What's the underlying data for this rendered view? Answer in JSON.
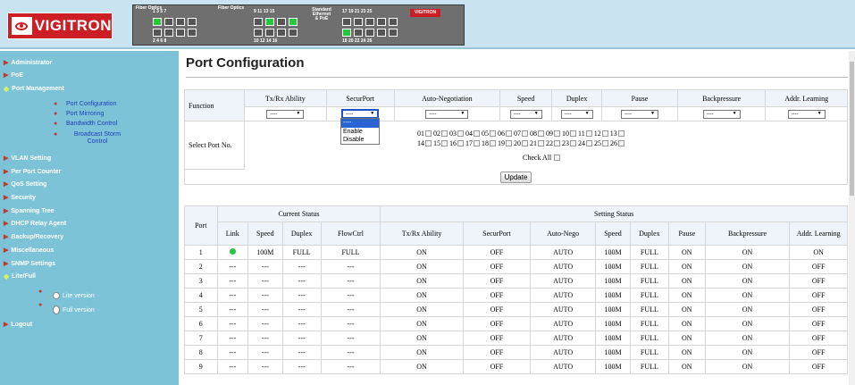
{
  "banner": {
    "logo_text": "VIGITRON",
    "switch_labels": {
      "fiber_optics_1": "Fiber Optics",
      "fiber_optics_2": "Fiber Optics",
      "standard": "Standard Ethernet & PoE",
      "brand": "VIGITRON",
      "group1_top": "1 3 5 7",
      "group1_bottom": "2 4 6 8",
      "group2_top": "9 11 13 15",
      "group2_bottom": "10 12 14 16",
      "group3_top": "17 19 21 23 25",
      "group3_bottom": "18 20 22 24 26"
    },
    "brand_color": "#cc1f25"
  },
  "sidebar": {
    "items": [
      {
        "label": "Administrator"
      },
      {
        "label": "PoE"
      },
      {
        "label": "Port Management"
      },
      {
        "label": "VLAN Setting"
      },
      {
        "label": "Per Port Counter"
      },
      {
        "label": "QoS Setting"
      },
      {
        "label": "Security"
      },
      {
        "label": "Spanning Tree"
      },
      {
        "label": "DHCP Relay Agent"
      },
      {
        "label": "Backup/Recovery"
      },
      {
        "label": "Miscellaneous"
      },
      {
        "label": "SNMP Settings"
      },
      {
        "label": "Lite/Full"
      },
      {
        "label": "Logout"
      }
    ],
    "port_mgmt_sub": [
      "Port Configuration",
      "Port Mirroring",
      "Bandwidth Control",
      "Broadcast Storm Control"
    ],
    "lite_full": {
      "lite": "Lite version",
      "full": "Full version",
      "selected": "full"
    }
  },
  "main": {
    "title": "Port Configuration",
    "config": {
      "function_label": "Function",
      "headers": [
        "Tx/Rx Ability",
        "SecurPort",
        "Auto-Negotiation",
        "Speed",
        "Duplex",
        "Pause",
        "Backpressure",
        "Addr. Learning"
      ],
      "select_value": "----",
      "dropdown_options": [
        "----",
        "Enable",
        "Disable"
      ],
      "select_port_label": "Select Port No.",
      "ports_row1": [
        "01",
        "02",
        "03",
        "04",
        "05",
        "06",
        "07",
        "08",
        "09",
        "10",
        "11",
        "12",
        "13"
      ],
      "ports_row2": [
        "14",
        "15",
        "16",
        "17",
        "18",
        "19",
        "20",
        "21",
        "22",
        "23",
        "24",
        "25",
        "26"
      ],
      "check_all": "Check All",
      "update": "Update"
    },
    "status": {
      "port_header": "Port",
      "current_header": "Current Status",
      "setting_header": "Setting Status",
      "columns": [
        "Link",
        "Speed",
        "Duplex",
        "FlowCtrl",
        "Tx/Rx Ability",
        "SecurPort",
        "Auto-Nego",
        "Speed",
        "Duplex",
        "Pause",
        "Backpressure",
        "Addr. Learning"
      ],
      "rows": [
        {
          "port": "1",
          "link": "up",
          "speed": "100M",
          "duplex": "FULL",
          "flow": "FULL",
          "txrx": "ON",
          "secur": "OFF",
          "nego": "AUTO",
          "sspeed": "100M",
          "sduplex": "FULL",
          "pause": "ON",
          "back": "ON",
          "learn": "ON"
        },
        {
          "port": "2",
          "link": "---",
          "speed": "---",
          "duplex": "---",
          "flow": "---",
          "txrx": "ON",
          "secur": "OFF",
          "nego": "AUTO",
          "sspeed": "100M",
          "sduplex": "FULL",
          "pause": "ON",
          "back": "ON",
          "learn": "OFF"
        },
        {
          "port": "3",
          "link": "---",
          "speed": "---",
          "duplex": "---",
          "flow": "---",
          "txrx": "ON",
          "secur": "OFF",
          "nego": "AUTO",
          "sspeed": "100M",
          "sduplex": "FULL",
          "pause": "ON",
          "back": "ON",
          "learn": "OFF"
        },
        {
          "port": "4",
          "link": "---",
          "speed": "---",
          "duplex": "---",
          "flow": "---",
          "txrx": "ON",
          "secur": "OFF",
          "nego": "AUTO",
          "sspeed": "100M",
          "sduplex": "FULL",
          "pause": "ON",
          "back": "ON",
          "learn": "OFF"
        },
        {
          "port": "5",
          "link": "---",
          "speed": "---",
          "duplex": "---",
          "flow": "---",
          "txrx": "ON",
          "secur": "OFF",
          "nego": "AUTO",
          "sspeed": "100M",
          "sduplex": "FULL",
          "pause": "ON",
          "back": "ON",
          "learn": "OFF"
        },
        {
          "port": "6",
          "link": "---",
          "speed": "---",
          "duplex": "---",
          "flow": "---",
          "txrx": "ON",
          "secur": "OFF",
          "nego": "AUTO",
          "sspeed": "100M",
          "sduplex": "FULL",
          "pause": "ON",
          "back": "ON",
          "learn": "OFF"
        },
        {
          "port": "7",
          "link": "---",
          "speed": "---",
          "duplex": "---",
          "flow": "---",
          "txrx": "ON",
          "secur": "OFF",
          "nego": "AUTO",
          "sspeed": "100M",
          "sduplex": "FULL",
          "pause": "ON",
          "back": "ON",
          "learn": "OFF"
        },
        {
          "port": "8",
          "link": "---",
          "speed": "---",
          "duplex": "---",
          "flow": "---",
          "txrx": "ON",
          "secur": "OFF",
          "nego": "AUTO",
          "sspeed": "100M",
          "sduplex": "FULL",
          "pause": "ON",
          "back": "ON",
          "learn": "OFF"
        },
        {
          "port": "9",
          "link": "---",
          "speed": "---",
          "duplex": "---",
          "flow": "---",
          "txrx": "ON",
          "secur": "OFF",
          "nego": "AUTO",
          "sspeed": "100M",
          "sduplex": "FULL",
          "pause": "ON",
          "back": "ON",
          "learn": "OFF"
        }
      ]
    }
  }
}
